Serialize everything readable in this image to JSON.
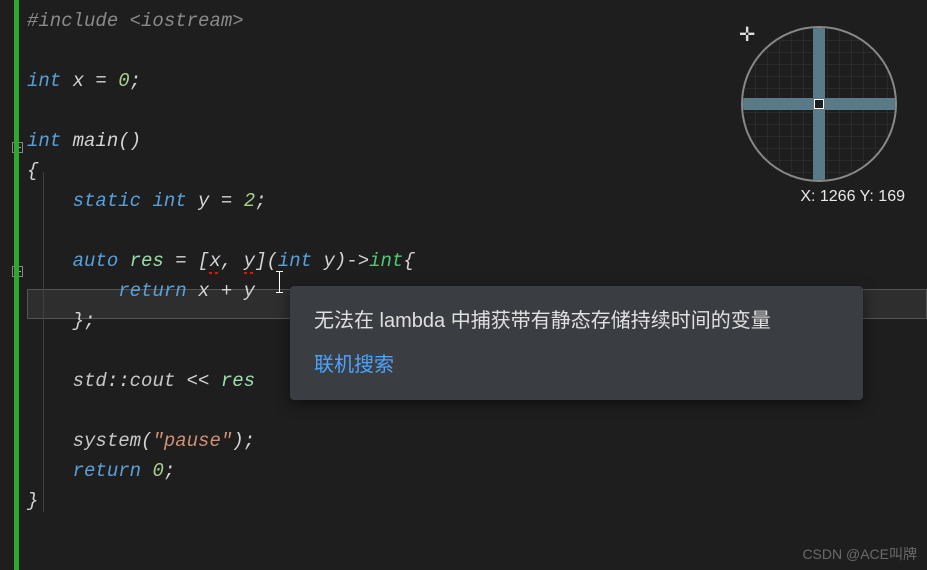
{
  "code": {
    "l1_pre": "#include ",
    "l1_inc": "<iostream>",
    "l3_kw": "int",
    "l3_var": "x",
    "l3_eq": " = ",
    "l3_num": "0",
    "l3_end": ";",
    "l5_kw": "int",
    "l5_fn": "main",
    "l5_par": "()",
    "l6_brace": "{",
    "l7_indent": "    ",
    "l7_kw1": "static ",
    "l7_kw2": "int",
    "l7_var": " y",
    "l7_eq": " = ",
    "l7_num": "2",
    "l7_end": ";",
    "l9_indent": "    ",
    "l9_kw": "auto",
    "l9_var": " res",
    "l9_eq": " = [",
    "l9_cap1": "x",
    "l9_sep": ", ",
    "l9_cap2": "y",
    "l9_close": "](",
    "l9_pt": "int",
    "l9_pn": " y",
    "l9_arrow": ")->",
    "l9_rt": "int",
    "l9_ob": "{",
    "l10_indent": "        ",
    "l10_kw": "return",
    "l10_sp": " ",
    "l10_a": "x",
    "l10_plus": " + ",
    "l10_b": "y",
    "l11_indent": "    ",
    "l11_close": "};",
    "l13_indent": "    ",
    "l13_ns": "std",
    "l13_dc": "::",
    "l13_cout": "cout",
    "l13_op": " << ",
    "l13_var": "res",
    "l15_indent": "    ",
    "l15_fn": "system",
    "l15_op": "(",
    "l15_str": "\"pause\"",
    "l15_cl": ");",
    "l16_indent": "    ",
    "l16_kw": "return",
    "l16_sp": " ",
    "l16_num": "0",
    "l16_end": ";",
    "l17_brace": "}"
  },
  "tooltip": {
    "message": "无法在 lambda 中捕获带有静态存储持续时间的变量",
    "link": "联机搜索"
  },
  "magnifier": {
    "coords": "X: 1266 Y: 169"
  },
  "watermark": "CSDN @ACE叫牌"
}
